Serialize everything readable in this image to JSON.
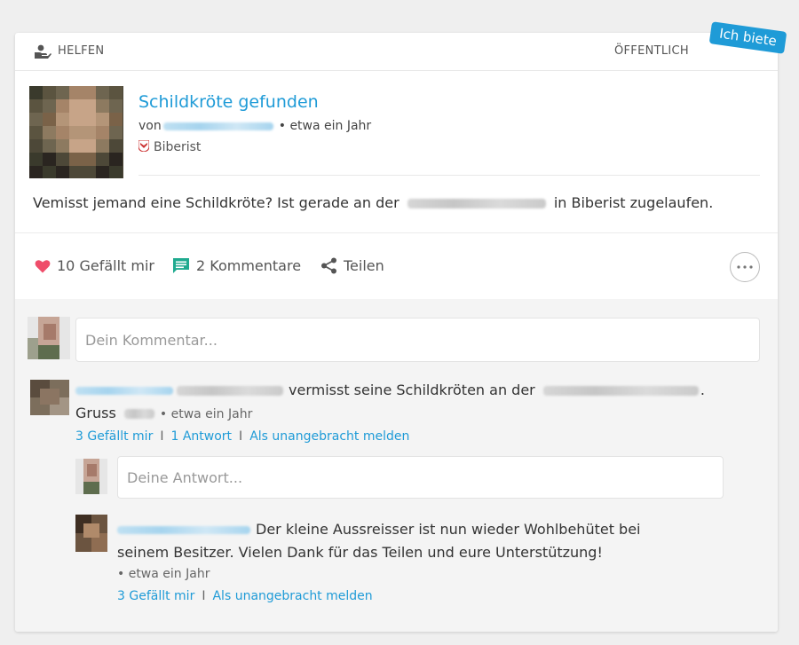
{
  "header": {
    "category_label": "HELFEN",
    "visibility_label": "ÖFFENTLICH",
    "badge_label": "Ich biete"
  },
  "post": {
    "title": "Schildkröte gefunden",
    "author_prefix": "von",
    "time_label": "• etwa ein Jahr",
    "location": "Biberist",
    "body_before": "Vemisst jemand eine Schildkröte? Ist gerade an der",
    "body_after": "in Biberist zugelaufen."
  },
  "actions": {
    "likes_label": "10 Gefällt mir",
    "comments_label": "2 Kommentare",
    "share_label": "Teilen",
    "heart_color": "#ef4d6a",
    "comment_color": "#1faa8f"
  },
  "comment_input": {
    "placeholder": "Dein Kommentar..."
  },
  "comment1": {
    "text_middle": "vermisst seine Schildkröten an der",
    "text_end": ".",
    "line2_prefix": "Gruss",
    "time_label": "• etwa ein Jahr",
    "likes_link": "3 Gefällt mir",
    "reply_link": "1 Antwort",
    "report_link": "Als unangebracht melden",
    "separator": "I"
  },
  "reply_input": {
    "placeholder": "Deine Antwort..."
  },
  "reply1": {
    "line1": "Der kleine Aussreisser ist nun wieder Wohlbehütet bei",
    "line2": "seinem Besitzer. Vielen Dank für das Teilen und eure Unterstützung!",
    "time_label": "• etwa ein Jahr",
    "likes_link": "3 Gefällt mir",
    "report_link": "Als unangebracht melden",
    "separator": "I"
  },
  "colors": {
    "accent": "#1f9bd7"
  }
}
